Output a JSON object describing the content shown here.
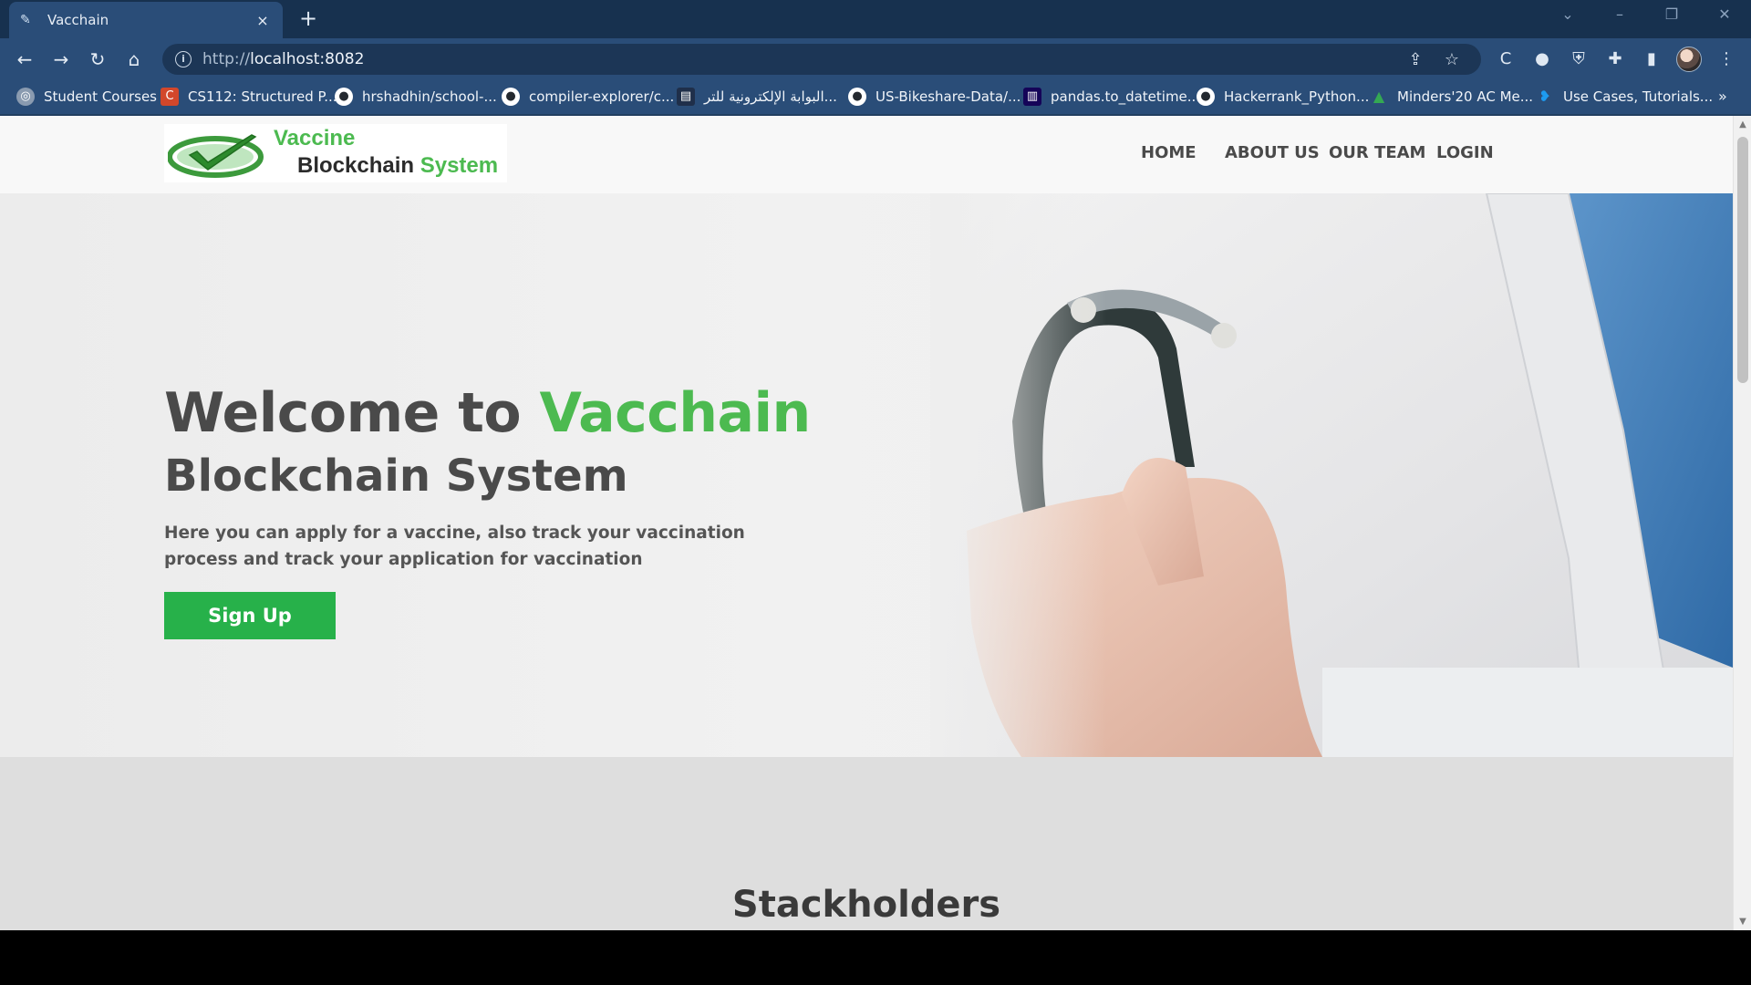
{
  "browser": {
    "tab": {
      "title": "Vacchain",
      "close_icon": "×"
    },
    "new_tab_icon": "+",
    "address": {
      "prefix": "http://",
      "host": "localhost:8082"
    },
    "bookmarks": [
      {
        "label": "Student Courses",
        "icon": "globe-icon",
        "color": "#8a9bb0"
      },
      {
        "label": "CS112: Structured P...",
        "icon": "course-icon",
        "color": "#d2472b"
      },
      {
        "label": "hrshadhin/school-...",
        "icon": "github-icon",
        "color": "#ffffff"
      },
      {
        "label": "compiler-explorer/c...",
        "icon": "github-icon",
        "color": "#ffffff"
      },
      {
        "label": "البوابة الإلكترونية للتر...",
        "icon": "portal-icon",
        "color": "#1f2f4a"
      },
      {
        "label": "US-Bikeshare-Data/...",
        "icon": "github-icon",
        "color": "#ffffff"
      },
      {
        "label": "pandas.to_datetime...",
        "icon": "pandas-icon",
        "color": "#150458"
      },
      {
        "label": "Hackerrank_Python...",
        "icon": "github-icon",
        "color": "#ffffff"
      },
      {
        "label": "Minders'20 AC Me...",
        "icon": "drive-icon",
        "color": "#34a853"
      },
      {
        "label": "Use Cases, Tutorials...",
        "icon": "twitter-icon",
        "color": "#1d9bf0"
      }
    ],
    "bookmarks_more": "»"
  },
  "site": {
    "logo": {
      "line1": "Vaccine",
      "line2_a": "Blockchain",
      "line2_b": "System"
    },
    "nav": [
      "HOME",
      "ABOUT US",
      "OUR TEAM",
      "LOGIN"
    ],
    "hero": {
      "title_a": "Welcome to",
      "title_b": "Vacchain",
      "subtitle": "Blockchain System",
      "description": "Here you can apply for a vaccine, also track your vaccination process and track your application for vaccination",
      "cta": "Sign Up"
    },
    "section2_title": "Stackholders"
  },
  "colors": {
    "brand_green": "#4cba50",
    "cta_green": "#27b14a",
    "text_dark": "#4a4a4a",
    "browser_frame": "#2a4d78"
  }
}
